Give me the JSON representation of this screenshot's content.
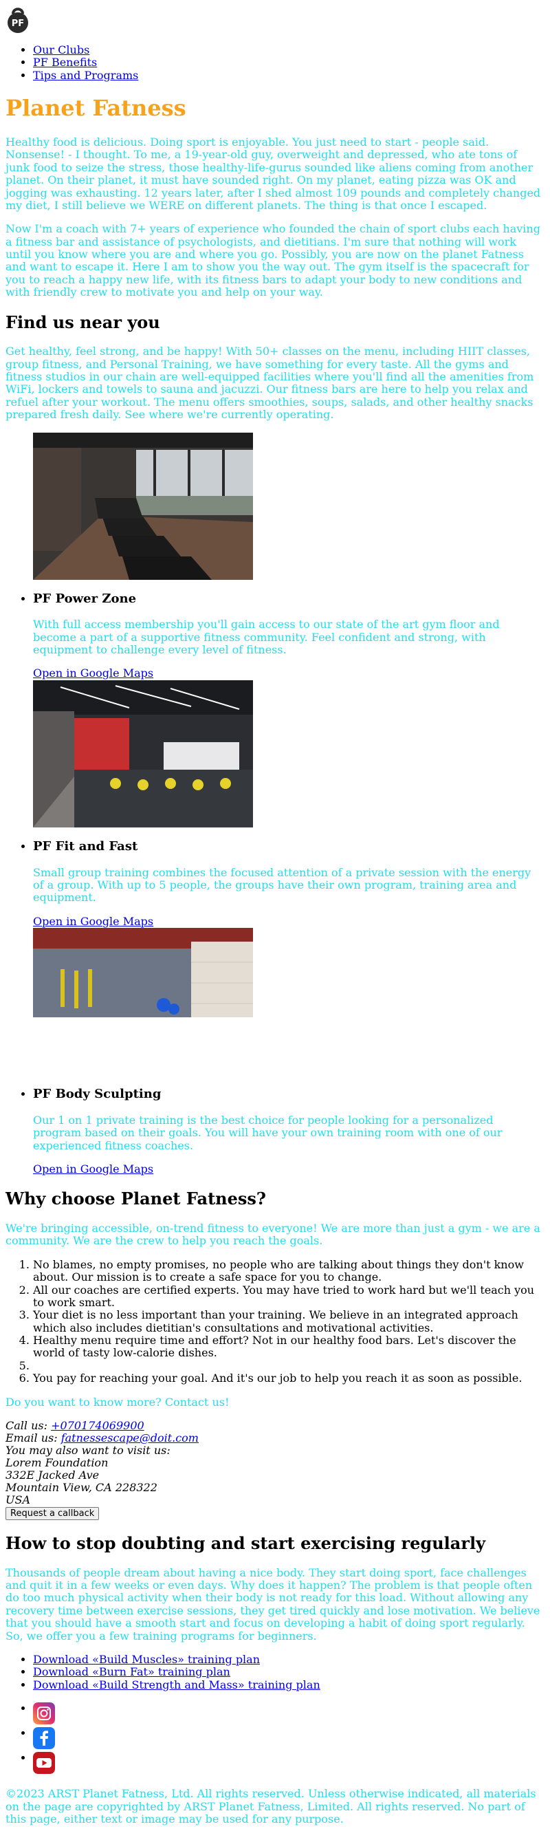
{
  "brand": {
    "logo_text": "PF"
  },
  "nav": [
    "Our Clubs",
    "PF Benefits",
    "Tips and Programs"
  ],
  "hero": {
    "title": "Planet Fatness",
    "p1": "Healthy food is delicious. Doing sport is enjoyable. You just need to start - people said. Nonsense! - I thought. To me, a 19-year-old guy, overweight and depressed, who ate tons of junk food to seize the stress, those healthy-life-gurus sounded like aliens coming from another planet. On their planet, it must have sounded right. On my planet, eating pizza was OK and jogging was exhausting. 12 years later, after I shed almost 109 pounds and completely changed my diet, I still believe we WERE on different planets. The thing is that once I escaped.",
    "p2": "Now I'm a coach with 7+ years of experience who founded the chain of sport clubs each having a fitness bar and assistance of psychologists, and dietitians. I'm sure that nothing will work until you know where you are and where you go. Possibly, you are now on the planet Fatness and want to escape it. Here I am to show you the way out. The gym itself is the spacecraft for you to reach a happy new life, with its fitness bars to adapt your body to new conditions and with friendly crew to motivate you and help on your way."
  },
  "find": {
    "heading": "Find us near you",
    "intro": "Get healthy, feel strong, and be happy! With 50+ classes on the menu, including HIIT classes, group fitness, and Personal Training, we have something for every taste. All the gyms and fitness studios in our chain are well-equipped facilities where you'll find all the amenities from WiFi, lockers and towels to sauna and jacuzzi. Our fitness bars are here to help you relax and refuel after your workout. The menu offers smoothies, soups, salads, and other healthy snacks prepared fresh daily. See where we're currently operating.",
    "clubs": [
      {
        "name": "PF Power Zone",
        "desc": "With full access membership you'll gain access to our state of the art gym floor and become a part of a supportive fitness community. Feel confident and strong, with equipment to challenge every level of fitness.",
        "link": "Open in Google Maps"
      },
      {
        "name": "PF Fit and Fast",
        "desc": "Small group training combines the focused attention of a private session with the energy of a group. With up to 5 people, the groups have their own program, training area and equipment.",
        "link": "Open in Google Maps"
      },
      {
        "name": "PF Body Sculpting",
        "desc": "Our 1 on 1 private training is the best choice for people looking for a personalized program based on their goals. You will have your own training room with one of our experienced fitness coaches.",
        "link": "Open in Google Maps"
      }
    ]
  },
  "why": {
    "heading": "Why choose Planet Fatness?",
    "intro": "We're bringing accessible, on-trend fitness to everyone! We are more than just a gym - we are a community. We are the crew to help you reach the goals.",
    "reasons": [
      "No blames, no empty promises, no people who are talking about things they don't know about. Our mission is to create a safe space for you to change.",
      "All our coaches are certified experts. You may have tried to work hard but we'll teach you to work smart.",
      "Your diet is no less important than your training. We believe in an integrated approach which also includes dietitian's consultations and motivational activities.",
      "Healthy menu require time and effort? Not in our healthy food bars. Let's discover the world of tasty low-calorie dishes.",
      "",
      "You pay for reaching your goal. And it's our job to help you reach it as soon as possible."
    ],
    "contact_prompt": "Do you want to know more? Contact us!",
    "call_label": "Call us:",
    "phone": "+070174069900",
    "email_label": "Email us:",
    "email": "fatnessescape@doit.com",
    "visit_label": "You may also want to visit us:",
    "addr1": "Lorem Foundation",
    "addr2": "332E Jacked Ave",
    "addr3": "Mountain View, CA 228322",
    "addr4": "USA",
    "callback_button": "Request a callback"
  },
  "tips": {
    "heading": "How to stop doubting and start exercising regularly",
    "intro": "Thousands of people dream about having a nice body. They start doing sport, face challenges and quit it in a few weeks or even days. Why does it happen? The problem is that people often do too much physical activity when their body is not ready for this load. Without allowing any recovery time between exercise sessions, they get tired quickly and lose motivation. We believe that you should have a smooth start and focus on developing a habit of doing sport regularly. So, we offer you a few training programs for beginners.",
    "downloads": [
      "Download «Build Muscles» training plan",
      "Download «Burn Fat» training plan",
      "Download «Build Strength and Mass» training plan"
    ]
  },
  "social": [
    "instagram-icon",
    "facebook-icon",
    "youtube-icon"
  ],
  "colors": {
    "accent": "#f7a21b",
    "text_cyan": "#22ddee",
    "link": "#0000ee"
  },
  "footer": "©2023 ARST Planet Fatness, Ltd. All rights reserved. Unless otherwise indicated, all materials on the page are copyrighted by ARST Planet Fatness, Limited. All rights reserved. No part of this page, either text or image may be used for any purpose."
}
